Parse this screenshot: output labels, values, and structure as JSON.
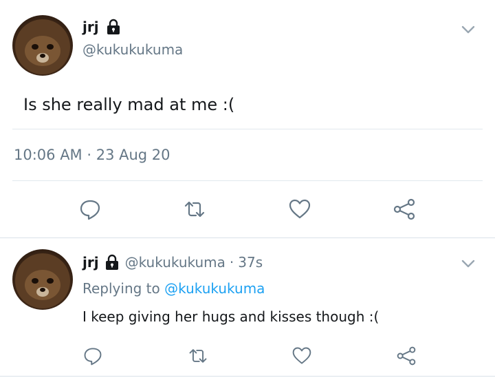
{
  "tweet1": {
    "name": "jrj",
    "handle": "@kukukukuma",
    "text": "Is she really mad at me :(",
    "timestamp": "10:06 AM · 23 Aug 20"
  },
  "tweet2": {
    "name": "jrj",
    "handle": "@kukukukuma",
    "separator": "·",
    "age": "37s",
    "replying_prefix": "Replying to",
    "replying_handle": "@kukukukuma",
    "text": "I keep giving her hugs and kisses though :("
  },
  "icons": {
    "lock": "lock-icon",
    "chevron": "chevron-down-icon",
    "reply": "reply-icon",
    "retweet": "retweet-icon",
    "like": "heart-icon",
    "share": "share-icon"
  },
  "colors": {
    "text": "#14171a",
    "secondary": "#657786",
    "link": "#1da1f2",
    "divider": "#e1e8ed"
  }
}
